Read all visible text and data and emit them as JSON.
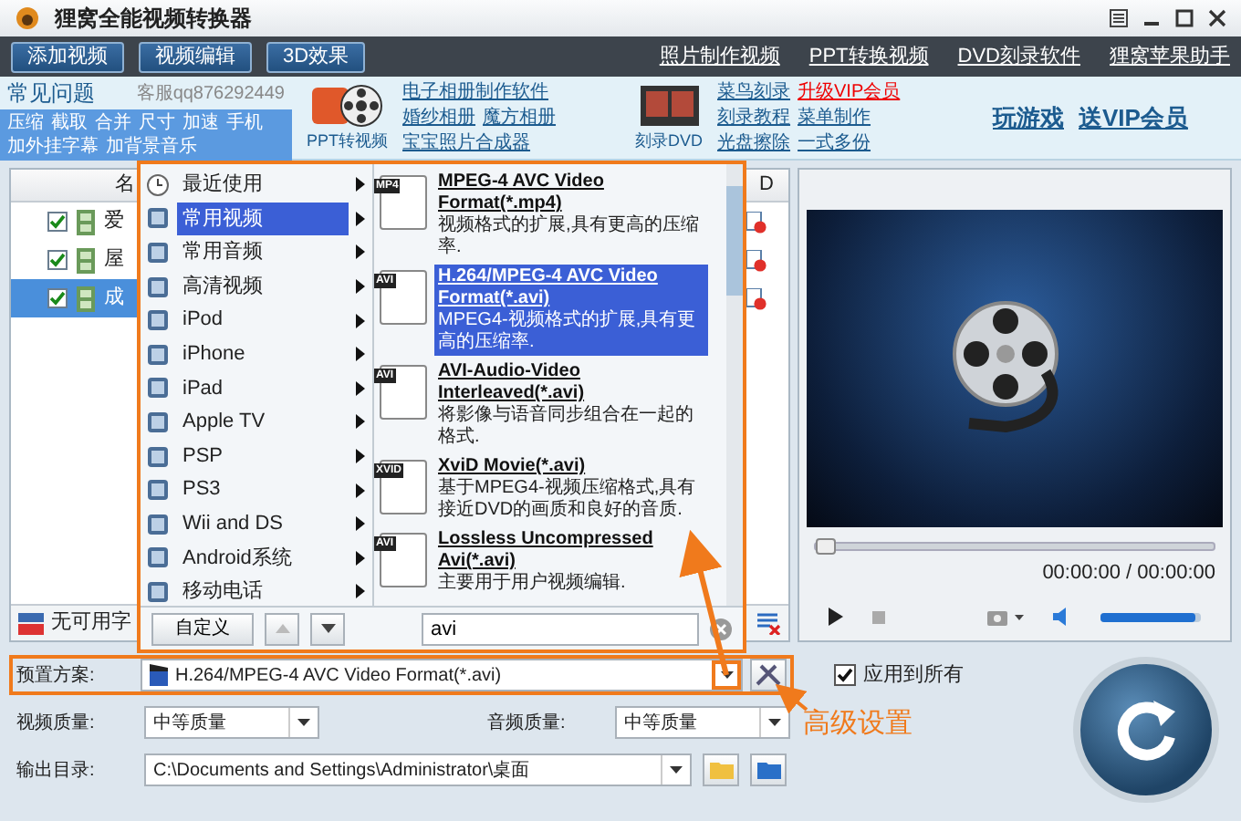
{
  "window": {
    "title": "狸窝全能视频转换器"
  },
  "toolbar": {
    "buttons": [
      "添加视频",
      "视频编辑",
      "3D效果"
    ],
    "links": [
      "照片制作视频",
      "PPT转换视频",
      "DVD刻录软件",
      "狸窝苹果助手"
    ]
  },
  "banner": {
    "faq": {
      "title": "常见问题",
      "support": "客服qq876292449",
      "links": [
        [
          "压缩",
          "截取",
          "合并",
          "尺寸",
          "加速",
          "手机"
        ],
        [
          "加外挂字幕",
          "加背景音乐"
        ]
      ]
    },
    "ppt": {
      "caption": "PPT转视频",
      "links": [
        [
          "电子相册制作软件"
        ],
        [
          "婚纱相册",
          "魔方相册"
        ],
        [
          "宝宝照片合成器"
        ]
      ]
    },
    "dvd": {
      "caption": "刻录DVD",
      "links": [
        [
          {
            "text": "菜鸟刻录",
            "highlight": false
          },
          {
            "text": "升级VIP会员",
            "highlight": true
          }
        ],
        [
          {
            "text": "刻录教程",
            "highlight": false
          },
          {
            "text": "菜单制作",
            "highlight": false
          }
        ],
        [
          {
            "text": "光盘擦除",
            "highlight": false
          },
          {
            "text": "一式多份",
            "highlight": false
          }
        ]
      ]
    },
    "promo": [
      "玩游戏",
      "送VIP会员"
    ]
  },
  "file_list": {
    "columns": [
      "名",
      "D"
    ],
    "rows": [
      {
        "name": "爱",
        "checked": true,
        "selected": false
      },
      {
        "name": "屋",
        "checked": true,
        "selected": false
      },
      {
        "name": "成",
        "checked": true,
        "selected": true
      }
    ],
    "subtitle": "无可用字"
  },
  "format_popup": {
    "categories": [
      {
        "label": "最近使用",
        "kind": "clock",
        "selected": false
      },
      {
        "label": "常用视频",
        "kind": "device",
        "selected": true
      },
      {
        "label": "常用音频",
        "kind": "device",
        "selected": false
      },
      {
        "label": "高清视频",
        "kind": "device",
        "selected": false
      },
      {
        "label": "iPod",
        "kind": "device",
        "selected": false
      },
      {
        "label": "iPhone",
        "kind": "device",
        "selected": false
      },
      {
        "label": "iPad",
        "kind": "device",
        "selected": false
      },
      {
        "label": "Apple TV",
        "kind": "device",
        "selected": false
      },
      {
        "label": "PSP",
        "kind": "device",
        "selected": false
      },
      {
        "label": "PS3",
        "kind": "device",
        "selected": false
      },
      {
        "label": "Wii and DS",
        "kind": "device",
        "selected": false
      },
      {
        "label": "Android系统",
        "kind": "device",
        "selected": false
      },
      {
        "label": "移动电话",
        "kind": "device",
        "selected": false
      }
    ],
    "formats": [
      {
        "tag": "MP4",
        "title": "MPEG-4 AVC Video Format(*.mp4)",
        "description": "视频格式的扩展,具有更高的压缩率.",
        "selected": false
      },
      {
        "tag": "AVI",
        "title": "H.264/MPEG-4 AVC Video Format(*.avi)",
        "description": "MPEG4-视频格式的扩展,具有更高的压缩率.",
        "selected": true
      },
      {
        "tag": "AVI",
        "title": "AVI-Audio-Video Interleaved(*.avi)",
        "description": "将影像与语音同步组合在一起的格式.",
        "selected": false
      },
      {
        "tag": "XVID",
        "title": "XviD Movie(*.avi)",
        "description": "基于MPEG4-视频压缩格式,具有接近DVD的画质和良好的音质.",
        "selected": false
      },
      {
        "tag": "AVI",
        "title": "Lossless Uncompressed Avi(*.avi)",
        "description": "主要用于用户视频编辑.",
        "selected": false
      }
    ],
    "custom_button": "自定义",
    "search": {
      "value": "avi"
    }
  },
  "preview": {
    "seek": {
      "level": 0
    },
    "time": "00:00:00 / 00:00:00",
    "volume": {
      "level": 0.95
    }
  },
  "settings": {
    "preset": {
      "label": "预置方案:",
      "value": "H.264/MPEG-4 AVC Video Format(*.avi)"
    },
    "apply_all": {
      "label": "应用到所有",
      "checked": true
    },
    "video_quality": {
      "label": "视频质量:",
      "value": "中等质量"
    },
    "audio_quality": {
      "label": "音频质量:",
      "value": "中等质量"
    },
    "output": {
      "label": "输出目录:",
      "value": "C:\\Documents and Settings\\Administrator\\桌面"
    }
  },
  "annotation": {
    "text": "高级设置"
  }
}
